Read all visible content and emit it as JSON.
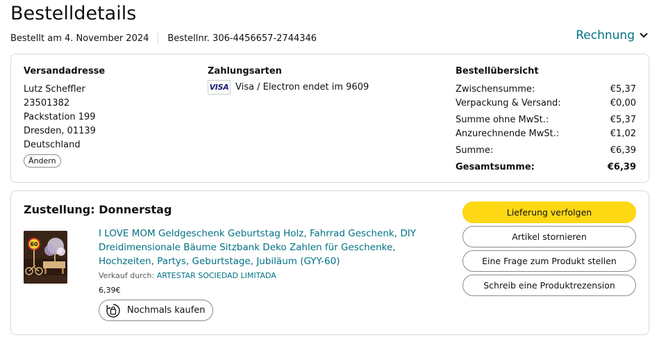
{
  "page": {
    "title": "Bestelldetails",
    "ordered_on": "Bestellt am 4. November 2024",
    "order_number": "Bestellnr. 306-4456657-2744346",
    "invoice_label": "Rechnung"
  },
  "shipping": {
    "heading": "Versandadresse",
    "lines": [
      "Lutz Scheffler",
      "23501382",
      "Packstation 199",
      "Dresden, 01139",
      "Deutschland"
    ],
    "change_label": "Ändern"
  },
  "payment": {
    "heading": "Zahlungsarten",
    "card_brand": "VISA",
    "description": "Visa / Electron endet im 9609"
  },
  "summary": {
    "heading": "Bestellübersicht",
    "rows": [
      {
        "label": "Zwischensumme:",
        "value": "€5,37"
      },
      {
        "label": "Verpackung & Versand:",
        "value": "€0,00"
      },
      {
        "label": "Summe ohne MwSt.:",
        "value": "€5,37"
      },
      {
        "label": "Anzurechnende MwSt.:",
        "value": "€1,02"
      },
      {
        "label": "Summe:",
        "value": "€6,39"
      },
      {
        "label": "Gesamtsumme:",
        "value": "€6,39"
      }
    ]
  },
  "delivery": {
    "heading": "Zustellung: Donnerstag",
    "product": {
      "title": "I LOVE MOM Geldgeschenk Geburtstag Holz, Fahrrad Geschenk, DIY Dreidimensionale Bäume Sitzbank Deko Zahlen für Geschenke, Hochzeiten, Partys, Geburtstage, Jubiläum (GYY-60)",
      "sold_by_label": "Verkauf durch:",
      "seller": "ARTESTAR SOCIEDAD LIMITADA",
      "price": "6,39€",
      "rebuy_label": "Nochmals kaufen",
      "image_badge": "60"
    },
    "actions": [
      "Lieferung verfolgen",
      "Artikel stornieren",
      "Eine Frage zum Produkt stellen",
      "Schreib eine Produktrezension"
    ]
  },
  "colors": {
    "link": "#007185",
    "primary_button": "#ffd814",
    "border": "#d5d9d9"
  }
}
